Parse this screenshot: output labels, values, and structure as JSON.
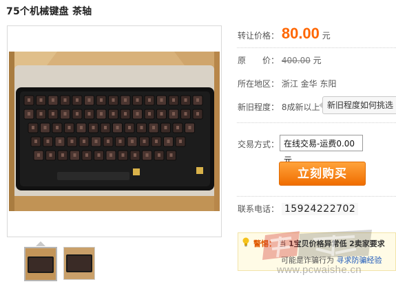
{
  "product": {
    "title": "75个机械键盘 茶轴"
  },
  "details": {
    "transfer_price_label": "转让价格：",
    "transfer_price_value": "80.00",
    "currency_unit": "元",
    "original_label": "原　　价：",
    "original_value": "400.00",
    "location_label": "所在地区：",
    "location_value": "浙江 金华 东阳",
    "condition_label": "新旧程度：",
    "condition_value": "8成新以上",
    "condition_tip": "新旧程度如何挑选",
    "trade_label": "交易方式：",
    "trade_value": "在线交易-运费0.00元",
    "buy_button": "立刻购买",
    "phone_label": "联系电话：",
    "phone_value": "15924222702"
  },
  "warning": {
    "strong": "警惕：",
    "text1": "当",
    "bold1": "1宝贝价格异常低",
    "bold2": "2卖家要求",
    "line2": "可能是诈骗行为",
    "link": "寻求防骗经验"
  },
  "watermark": {
    "url": "www.pcwaishe.cn"
  },
  "colors": {
    "price": "#ff6600",
    "button": "#f38200",
    "warning_bg": "#fffbe6",
    "link": "#1a56b8"
  },
  "icons": [
    "bulb-icon"
  ]
}
